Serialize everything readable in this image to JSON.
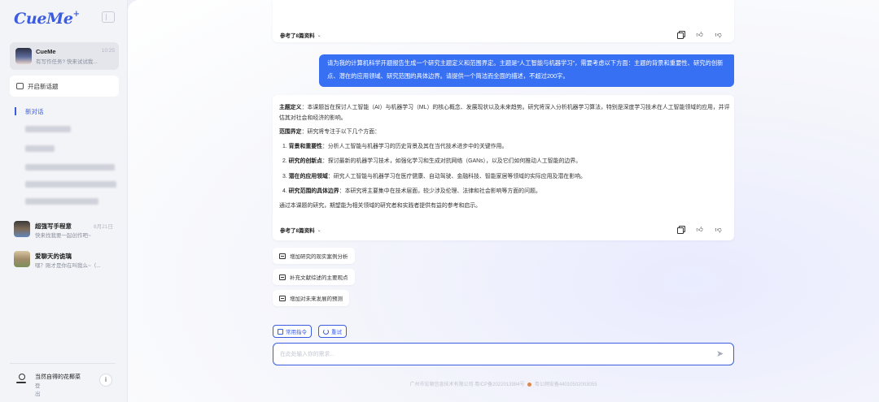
{
  "app": {
    "logo": "CueMe",
    "logo_sparkle": "+"
  },
  "sidebar": {
    "active_chat": {
      "title": "CueMe",
      "time": "10:25",
      "subtitle": "有写作任务? 快来试试我..."
    },
    "new_topic_label": "开启新话题",
    "history_active_label": "新对话",
    "contacts": [
      {
        "name": "超强写手程意",
        "date": "8月21日",
        "subtitle": "快来找我要一起创作吧~"
      },
      {
        "name": "爱聊天的诡璃",
        "date": "",
        "subtitle": "嘿？刚才是你在叫我么~（..."
      }
    ],
    "user": {
      "name": "当然自得的花椰菜",
      "action": "登出",
      "info_icon": "i"
    }
  },
  "conversation": {
    "refs_label": "参考了8篇资料",
    "user_message": "请为我的计算机科学开题报告生成一个研究主题定义和范围界定。主题是“人工智能与机器学习”，需要考虑以下方面：主题的背景和重要性、研究的创新点、潜在的应用领域、研究范围的具体边界。请提供一个简洁而全面的描述，不超过200字。",
    "answer": {
      "def_label": "主题定义",
      "def_text": "：本课题旨在探讨人工智能（AI）与机器学习（ML）的核心概念、发展现状以及未来趋势。研究将深入分析机器学习算法，特别是深度学习技术在人工智能领域的应用，并评估其对社会和经济的影响。",
      "scope_label": "范围界定",
      "scope_text": "：研究将专注于以下几个方面：",
      "items": [
        {
          "num": "1. ",
          "label": "背景和重要性",
          "text": "：分析人工智能与机器学习的历史背景及其在当代技术进步中的关键作用。"
        },
        {
          "num": "2. ",
          "label": "研究的创新点",
          "text": "：探讨最新的机器学习技术，如强化学习和生成对抗网络（GANs），以及它们如何推动人工智能的边界。"
        },
        {
          "num": "3. ",
          "label": "潜在的应用领域",
          "text": "：研究人工智能与机器学习在医疗健康、自动驾驶、金融科技、智能家居等领域的实际应用及潜在影响。"
        },
        {
          "num": "4. ",
          "label": "研究范围的具体边界",
          "text": "：本研究将主要集中在技术层面，较少涉及伦理、法律和社会影响等方面的问题。"
        }
      ],
      "conclusion": "通过本课题的研究，期望能为相关领域的研究者和实践者提供有益的参考和启示。"
    },
    "suggestions": [
      "增加研究的现实案例分析",
      "补充文献综述的主要观点",
      "增加对未来发展的预测"
    ],
    "actions": {
      "common_commands": "常用指令",
      "retry": "重试"
    },
    "composer_placeholder": "在此处输入你的需求..."
  },
  "footer": {
    "left": "广州市宏顿信息技术有限公司 粤ICP备2022013984号",
    "right": "粤公网安备44010502003055"
  },
  "colors": {
    "accent": "#3b5ce0",
    "bubble": "#3870f4"
  }
}
